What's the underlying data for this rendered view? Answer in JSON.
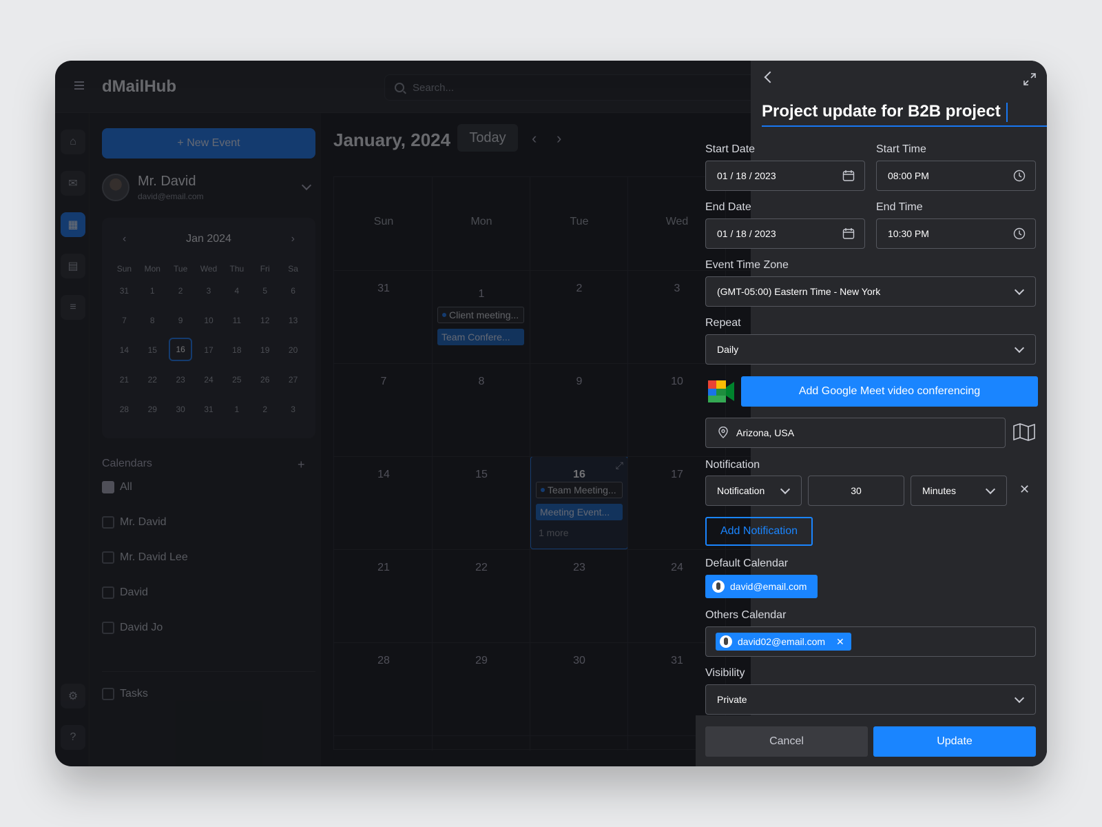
{
  "app": {
    "brand": "dMailHub",
    "search_placeholder": "Search...",
    "new_event": "+ New Event",
    "user": {
      "name": "Mr. David",
      "email": "david@email.com"
    },
    "mini_calendar": {
      "title": "Jan 2024",
      "weekdays": [
        "Sun",
        "Mon",
        "Tue",
        "Wed",
        "Thu",
        "Fri",
        "Sa"
      ],
      "weeks": [
        [
          "31",
          "1",
          "2",
          "3",
          "4",
          "5",
          "6"
        ],
        [
          "7",
          "8",
          "9",
          "10",
          "11",
          "12",
          "13"
        ],
        [
          "14",
          "15",
          "16",
          "17",
          "18",
          "19",
          "20"
        ],
        [
          "21",
          "22",
          "23",
          "24",
          "25",
          "26",
          "27"
        ],
        [
          "28",
          "29",
          "30",
          "31",
          "1",
          "2",
          "3"
        ]
      ],
      "selected": "16"
    },
    "calendars_label": "Calendars",
    "calendars": [
      "All",
      "Mr. David",
      "Mr. David Lee",
      "David",
      "David Jo"
    ],
    "tasks_label": "Tasks",
    "month_title": "January, 2024",
    "today_label": "Today",
    "weekday_headers": [
      "Sun",
      "Mon",
      "Tue",
      "Wed"
    ],
    "week_rows": [
      [
        "31",
        "1",
        "2",
        "3"
      ],
      [
        "7",
        "8",
        "9",
        "10"
      ],
      [
        "14",
        "15",
        "16",
        "17"
      ],
      [
        "21",
        "22",
        "23",
        "24"
      ],
      [
        "28",
        "29",
        "30",
        "31"
      ]
    ],
    "events": {
      "client_meeting": "Client meeting...",
      "team_conference": "Team Confere...",
      "team_meeting": "Team Meeting...",
      "meeting_event": "Meeting Event...",
      "more": "1 more"
    }
  },
  "panel": {
    "title": "Project update for B2B project",
    "start_date_label": "Start Date",
    "start_date": "01 / 18 / 2023",
    "start_time_label": "Start Time",
    "start_time": "08:00 PM",
    "end_date_label": "End Date",
    "end_date": "01 / 18 / 2023",
    "end_time_label": "End Time",
    "end_time": "10:30 PM",
    "timezone_label": "Event Time Zone",
    "timezone": "(GMT-05:00) Eastern Time - New York",
    "repeat_label": "Repeat",
    "repeat": "Daily",
    "meet_button": "Add Google Meet video conferencing",
    "location": "Arizona, USA",
    "notification_label": "Notification",
    "notification_type": "Notification",
    "notification_value": "30",
    "notification_unit": "Minutes",
    "add_notification": "Add Notification",
    "default_calendar_label": "Default Calendar",
    "default_calendar": "david@email.com",
    "others_calendar_label": "Others Calendar",
    "others_calendar": "david02@email.com",
    "visibility_label": "Visibility",
    "visibility": "Private",
    "cancel": "Cancel",
    "update": "Update"
  }
}
